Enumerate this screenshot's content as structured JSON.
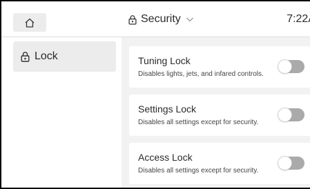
{
  "sidebar": {
    "home_icon": "home-icon",
    "items": [
      {
        "label": "Lock",
        "icon": "lock-icon",
        "selected": true
      }
    ]
  },
  "header": {
    "title": "Security",
    "title_icon": "lock-icon",
    "dropdown_icon": "chevron-down-icon",
    "time": "7:22A"
  },
  "settings": [
    {
      "title": "Tuning Lock",
      "description": "Disables lights, jets, and infared controls.",
      "enabled": false
    },
    {
      "title": "Settings Lock",
      "description": "Disables all settings except for security.",
      "enabled": false
    },
    {
      "title": "Access Lock",
      "description": "Disables all settings except for security.",
      "enabled": false
    }
  ],
  "colors": {
    "toggle_off": "#aaaaaa",
    "card_bg": "#ffffff",
    "page_bg": "#f2f2f2",
    "selected_bg": "#ececec"
  }
}
